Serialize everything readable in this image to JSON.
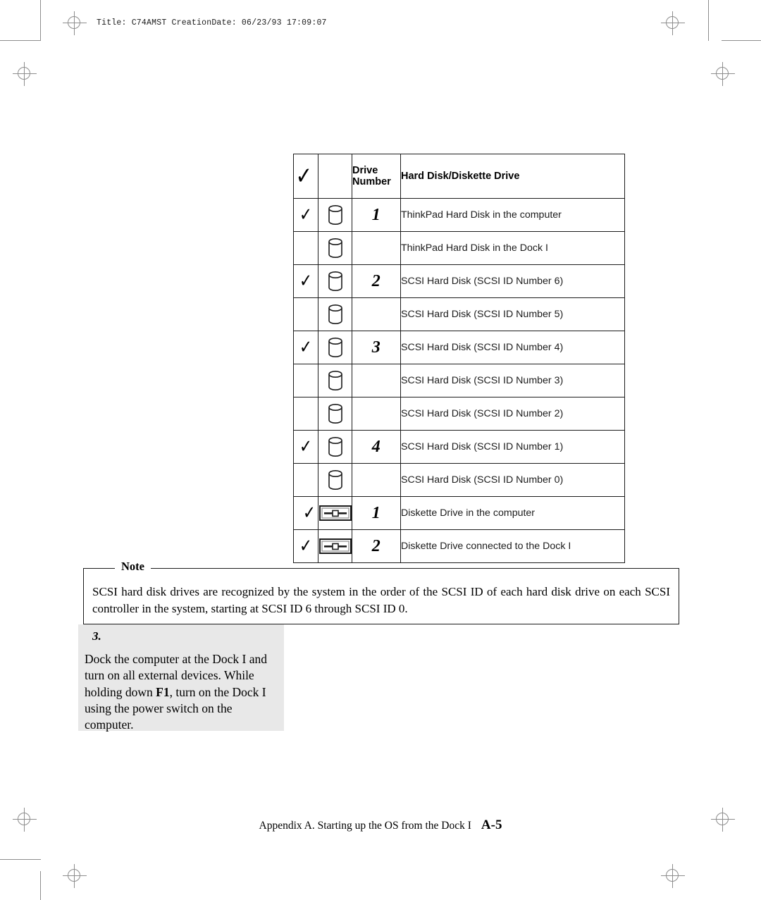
{
  "page": {
    "running_head": "Title: C74AMST CreationDate: 06/23/93 17:09:07",
    "background_color": "#ffffff",
    "ink_color": "#000000",
    "mark_color": "#8d8d8d"
  },
  "table": {
    "headers": {
      "check": "",
      "icon": "",
      "drive_number": "Drive\nNumber",
      "drive_number_line1": "Drive",
      "drive_number_line2": "Number",
      "description": "Hard Disk/Diskette Drive"
    },
    "rows": [
      {
        "checked": true,
        "icon": "hard-disk-icon",
        "number": "1",
        "description": "ThinkPad Hard Disk in the computer"
      },
      {
        "checked": false,
        "icon": "hard-disk-icon",
        "number": "",
        "description": "ThinkPad Hard Disk in the Dock I"
      },
      {
        "checked": true,
        "icon": "hard-disk-icon",
        "number": "2",
        "description": "SCSI Hard Disk (SCSI ID Number 6)"
      },
      {
        "checked": false,
        "icon": "hard-disk-icon",
        "number": "",
        "description": "SCSI Hard Disk (SCSI ID Number 5)"
      },
      {
        "checked": true,
        "icon": "hard-disk-icon",
        "number": "3",
        "description": "SCSI Hard Disk (SCSI ID Number 4)"
      },
      {
        "checked": false,
        "icon": "hard-disk-icon",
        "number": "",
        "description": "SCSI Hard Disk (SCSI ID Number 3)"
      },
      {
        "checked": false,
        "icon": "hard-disk-icon",
        "number": "",
        "description": "SCSI Hard Disk (SCSI ID Number 2)"
      },
      {
        "checked": true,
        "icon": "hard-disk-icon",
        "number": "4",
        "description": "SCSI Hard Disk (SCSI ID Number 1)"
      },
      {
        "checked": false,
        "icon": "hard-disk-icon",
        "number": "",
        "description": "SCSI Hard Disk (SCSI ID Number 0)"
      },
      {
        "checked": true,
        "icon": "diskette-drive-icon",
        "number": "1",
        "description": "Diskette Drive in the computer"
      },
      {
        "checked": true,
        "icon": "diskette-drive-icon",
        "number": "2",
        "description": "Diskette Drive connected to the Dock I"
      }
    ]
  },
  "note": {
    "label": "Note",
    "body": "SCSI hard disk drives are recognized by the system in the order of the SCSI ID of each hard disk drive on each SCSI controller in the system, starting at SCSI ID 6 through SCSI ID 0."
  },
  "step": {
    "number": "3.",
    "text_before_bold": "Dock the computer at the Dock I and turn on all external devices.  While holding down ",
    "bold": "F1",
    "text_after_bold": ", turn on the Dock I using the power switch on the computer."
  },
  "footer": {
    "text": "Appendix A.  Starting up the OS from the Dock I",
    "page": "A-5"
  }
}
